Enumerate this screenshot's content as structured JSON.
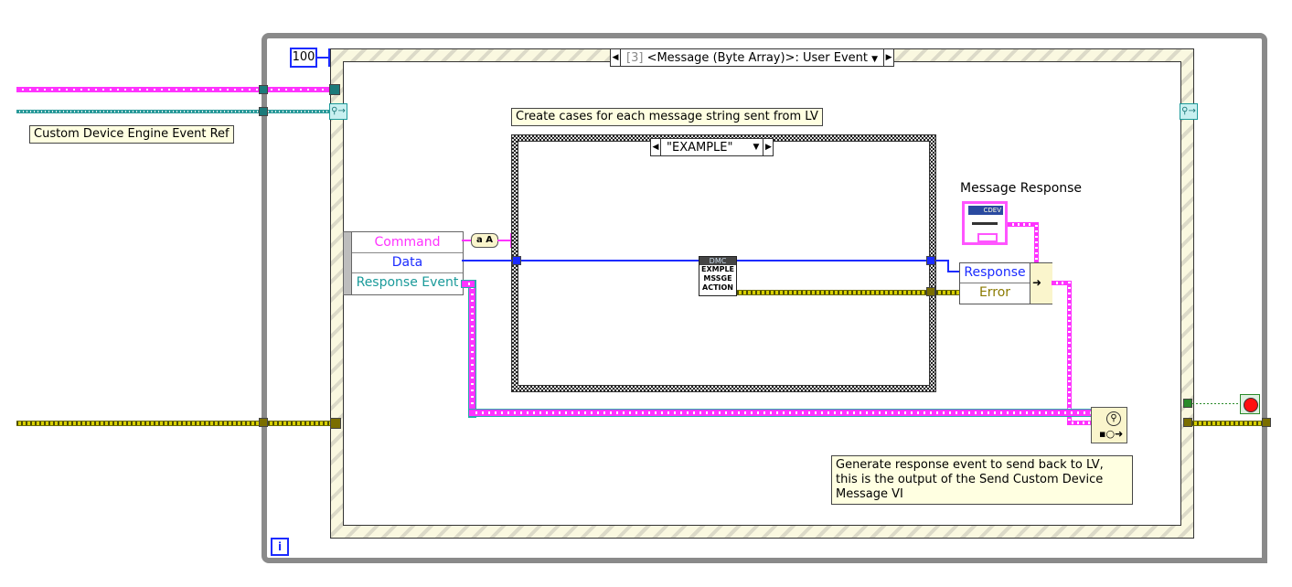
{
  "diagram": {
    "type": "LabVIEW block diagram",
    "while_loop": {
      "iteration_terminal": "i",
      "timeout_constant": "100",
      "stop_terminal": "stop"
    },
    "event_structure": {
      "case_selector": {
        "index": "[3]",
        "label": "<Message (Byte Array)>: User Event"
      },
      "event_data_node": {
        "elements": [
          {
            "label": "Command",
            "color": "#ff33ff"
          },
          {
            "label": "Data",
            "color": "#1b2bff"
          },
          {
            "label": "Response Event",
            "color": "#1a9a9a"
          }
        ]
      }
    },
    "case_structure": {
      "selector_label": "\"EXAMPLE\"",
      "comment": "Create cases for each message string sent from LV",
      "subvi": {
        "header": "DMC",
        "lines": [
          "EXMPLE",
          "MSSGE",
          "ACTION"
        ]
      }
    },
    "labels": {
      "event_ref": "Custom Device Engine Event Ref",
      "message_response": "Message Response",
      "response_comment": "Generate response event to send back to LV, this is the output of the Send Custom Device Message VI",
      "response_comment_lines": [
        "Generate response event to send back to LV,",
        "this is the output of the Send Custom Device",
        "Message VI"
      ]
    },
    "bundle_by_name": {
      "elements": [
        {
          "label": "Response",
          "color": "#1b2bff"
        },
        {
          "label": "Error",
          "color": "#8a7a00"
        }
      ]
    },
    "message_response_constant": {
      "badge": "CDEV"
    },
    "string_conversion": "a A",
    "colors": {
      "loop_frame": "#8a8a8a",
      "string_wire": "#ff33ff",
      "event_ref_wire": "#2a9a9a",
      "data_wire": "#1b2bff",
      "error_wire": "#8a7a00",
      "boolean_wire": "#2a8a2a",
      "comment_bg": "#ffffe1"
    }
  }
}
